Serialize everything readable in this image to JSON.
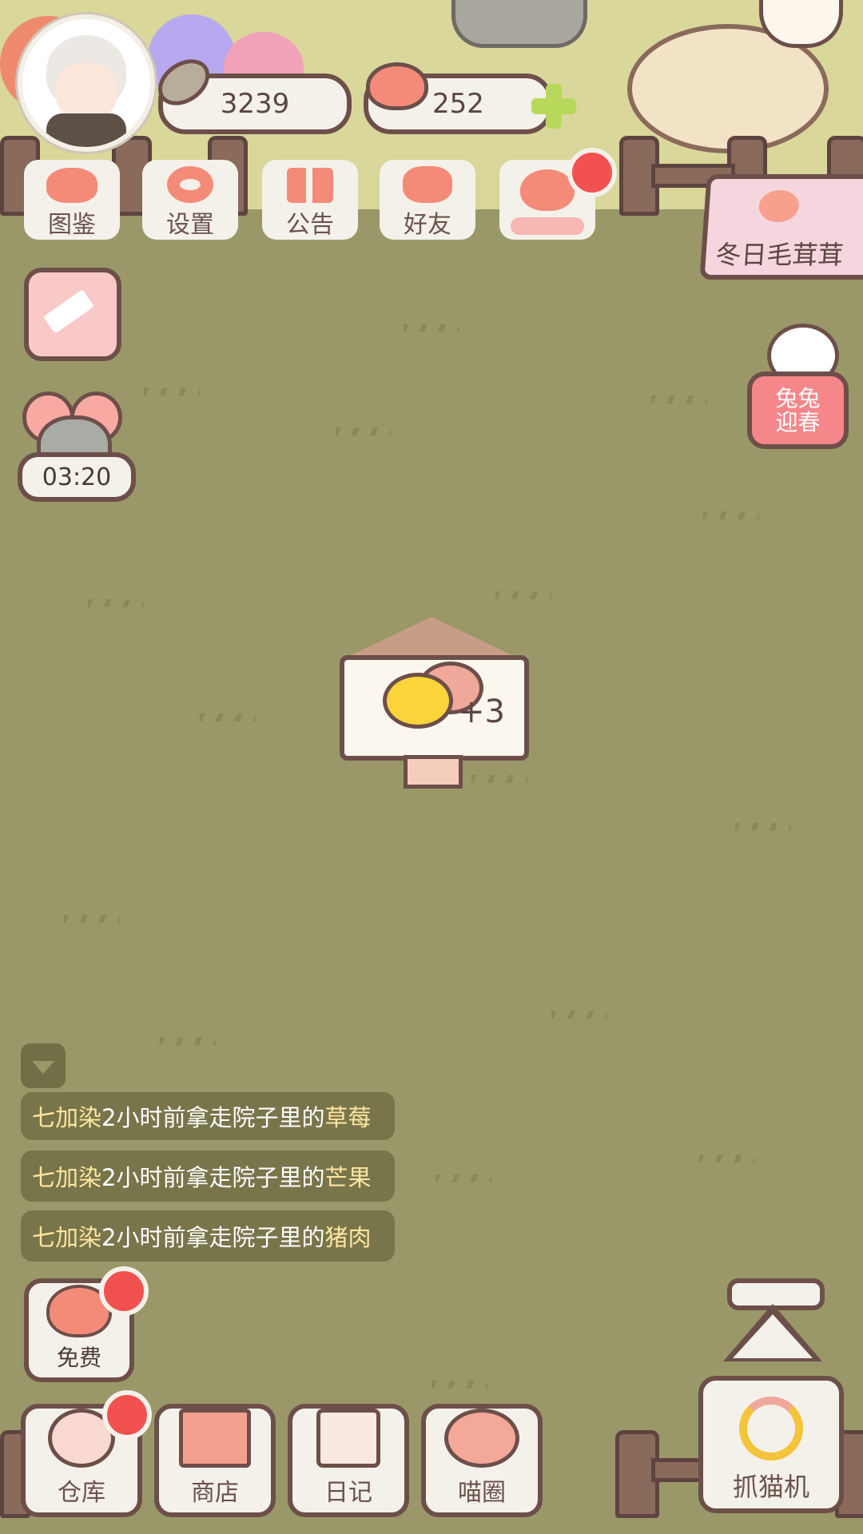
{
  "header": {
    "fish_currency": "3239",
    "heart_currency": "252"
  },
  "menu": [
    {
      "label": "图鉴",
      "icon": "cat-face-icon"
    },
    {
      "label": "设置",
      "icon": "gear-icon"
    },
    {
      "label": "公告",
      "icon": "gift-icon"
    },
    {
      "label": "好友",
      "icon": "friends-icon"
    },
    {
      "label": "",
      "icon": "hearts-icon"
    }
  ],
  "event_banner": "冬日毛茸茸",
  "rabbit_event": "兔兔\n迎春",
  "mouse_timer": "03:20",
  "doghouse_count": "+3",
  "messages": [
    {
      "name": "七加染",
      "mid": "2小时前拿走院子里的",
      "item": "草莓"
    },
    {
      "name": "七加染",
      "mid": "2小时前拿走院子里的",
      "item": "芒果"
    },
    {
      "name": "七加染",
      "mid": "2小时前拿走院子里的",
      "item": "猪肉"
    }
  ],
  "free_button": "免费",
  "bottom_nav": [
    {
      "label": "仓库",
      "icon": "storage-bowl-icon"
    },
    {
      "label": "商店",
      "icon": "shop-icon"
    },
    {
      "label": "日记",
      "icon": "diary-icon"
    },
    {
      "label": "喵圈",
      "icon": "cat-planet-icon"
    }
  ],
  "claw_machine": "抓猫机",
  "colors": {
    "grass": "#9a9868",
    "top_strip": "#d9d79a",
    "badge": "#f2524f",
    "highlight_text": "#ffe6a0",
    "border": "#6d4f4a"
  }
}
